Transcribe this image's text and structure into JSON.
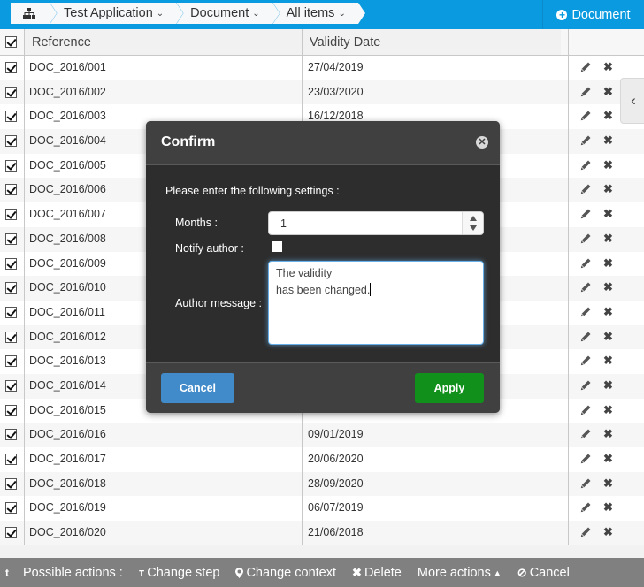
{
  "topbar": {
    "breadcrumbs": [
      {
        "label": "Test Application",
        "icon": "chevron-down-icon"
      },
      {
        "label": "Document",
        "icon": "chevron-down-icon"
      },
      {
        "label": "All items",
        "icon": "chevron-down-icon"
      }
    ],
    "home_icon": "sitemap-icon",
    "new_button": {
      "label": "Document",
      "icon": "plus-circle-icon"
    }
  },
  "grid": {
    "columns": [
      "Reference",
      "Validity Date"
    ],
    "select_all_checked": true,
    "rows": [
      {
        "reference": "DOC_2016/001",
        "date": "27/04/2019",
        "checked": true
      },
      {
        "reference": "DOC_2016/002",
        "date": "23/03/2020",
        "checked": true
      },
      {
        "reference": "DOC_2016/003",
        "date": "16/12/2018",
        "checked": true
      },
      {
        "reference": "DOC_2016/004",
        "date": "",
        "checked": true
      },
      {
        "reference": "DOC_2016/005",
        "date": "",
        "checked": true
      },
      {
        "reference": "DOC_2016/006",
        "date": "",
        "checked": true
      },
      {
        "reference": "DOC_2016/007",
        "date": "",
        "checked": true
      },
      {
        "reference": "DOC_2016/008",
        "date": "",
        "checked": true
      },
      {
        "reference": "DOC_2016/009",
        "date": "",
        "checked": true
      },
      {
        "reference": "DOC_2016/010",
        "date": "",
        "checked": true
      },
      {
        "reference": "DOC_2016/011",
        "date": "",
        "checked": true
      },
      {
        "reference": "DOC_2016/012",
        "date": "",
        "checked": true
      },
      {
        "reference": "DOC_2016/013",
        "date": "",
        "checked": true
      },
      {
        "reference": "DOC_2016/014",
        "date": "",
        "checked": true
      },
      {
        "reference": "DOC_2016/015",
        "date": "",
        "checked": true
      },
      {
        "reference": "DOC_2016/016",
        "date": "09/01/2019",
        "checked": true
      },
      {
        "reference": "DOC_2016/017",
        "date": "20/06/2020",
        "checked": true
      },
      {
        "reference": "DOC_2016/018",
        "date": "28/09/2020",
        "checked": true
      },
      {
        "reference": "DOC_2016/019",
        "date": "06/07/2019",
        "checked": true
      },
      {
        "reference": "DOC_2016/020",
        "date": "21/06/2018",
        "checked": true
      }
    ],
    "row_actions": [
      "pencil-icon",
      "x-icon"
    ],
    "side_toggle_icon": "chevron-left-icon"
  },
  "modal": {
    "title": "Confirm",
    "intro": "Please enter the following settings :",
    "months_label": "Months :",
    "months_value": "1",
    "notify_label": "Notify author :",
    "notify_checked": false,
    "message_label": "Author message :",
    "message_value": "The validity\nhas been changed.",
    "cancel_label": "Cancel",
    "apply_label": "Apply"
  },
  "actionbar": {
    "first_icon": "t",
    "label": "Possible actions :",
    "items": [
      {
        "label": "Change step",
        "icon": "branch-icon"
      },
      {
        "label": "Change context",
        "icon": "map-marker-icon"
      },
      {
        "label": "Delete",
        "icon": "x-icon"
      },
      {
        "label": "More actions",
        "icon": "caret-up-icon"
      },
      {
        "label": "Cancel",
        "icon": "ban-icon"
      }
    ]
  },
  "colors": {
    "topbar": "#0a9ae0",
    "modal_bg": "#2d2d2d",
    "cancel": "#428bca",
    "apply": "#11901b",
    "actionbar": "#808080"
  }
}
